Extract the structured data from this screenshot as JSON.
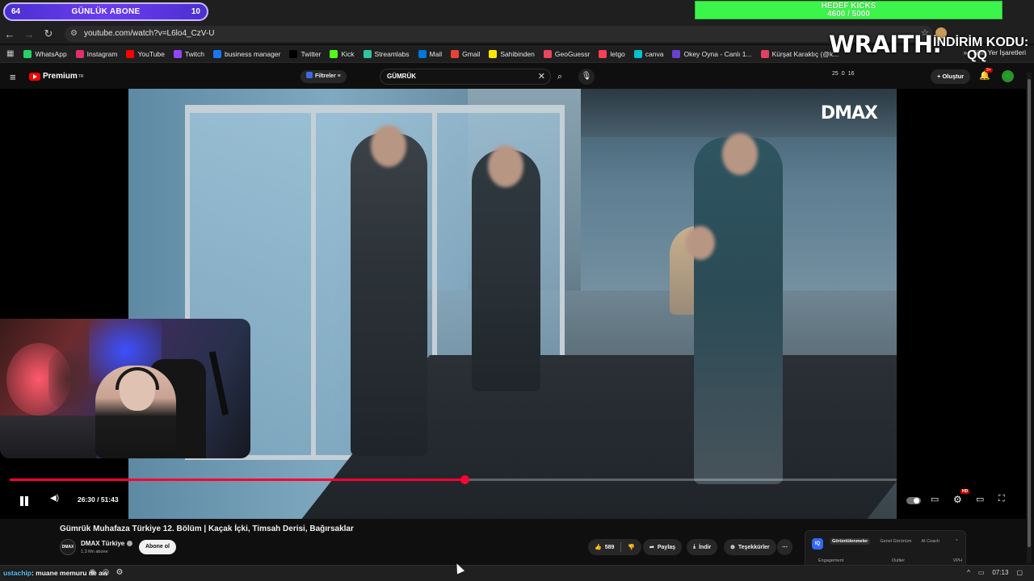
{
  "overlay": {
    "sub_goal": {
      "left": "64",
      "title": "GÜNLÜK ABONE",
      "right": "10"
    },
    "kicks_goal": {
      "title": "HEDEF KICKS",
      "value": "4600 / 5000",
      "progress": 0.92
    },
    "sponsor": {
      "brand": "WRAITH.",
      "promo_label": "İNDİRİM KODU:",
      "promo_code": "QQ"
    }
  },
  "browser": {
    "url": "youtube.com/watch?v=L6lo4_CzV-U",
    "bookmarks": [
      {
        "label": "WhatsApp",
        "color": "#25d366"
      },
      {
        "label": "Instagram",
        "color": "#e1306c"
      },
      {
        "label": "YouTube",
        "color": "#ff0000"
      },
      {
        "label": "Twitch",
        "color": "#9146ff"
      },
      {
        "label": "business manager",
        "color": "#1877f2"
      },
      {
        "label": "Twitter",
        "color": "#000000"
      },
      {
        "label": "Kick",
        "color": "#53fc18"
      },
      {
        "label": "Streamlabs",
        "color": "#31c3a2"
      },
      {
        "label": "Mail",
        "color": "#0078d4"
      },
      {
        "label": "Gmail",
        "color": "#ea4335"
      },
      {
        "label": "Sahibinden",
        "color": "#ffe800"
      },
      {
        "label": "GeoGuessr",
        "color": "#e9475e"
      },
      {
        "label": "letgo",
        "color": "#ff3f55"
      },
      {
        "label": "canva",
        "color": "#00c4cc"
      },
      {
        "label": "Okey Oyna - Canlı 1...",
        "color": "#6c3fd0"
      },
      {
        "label": "Kürşat Karaklıç (@k...",
        "color": "#e4405f"
      }
    ],
    "bookmarks_more": "»",
    "all_bookmarks": "Tüm Yer İşaretleri"
  },
  "youtube": {
    "brand": "Premium",
    "brand_region": "TR",
    "filters_label": "Filtreler",
    "search_value": "GÜMRÜK",
    "stats": [
      "25",
      "0",
      "16"
    ],
    "create_label": "Oluştur",
    "notif_count": "9+",
    "account_initial": "K"
  },
  "player": {
    "watermark": "DMAX",
    "time": "26:30 / 51:43",
    "progress": 0.5124,
    "hd_badge": "HD"
  },
  "video": {
    "title": "Gümrük Muhafaza Türkiye 12. Bölüm | Kaçak İçki, Timsah Derisi, Bağırsaklar",
    "channel": "DMAX Türkiye",
    "channel_avatar_text": "DMAX",
    "subscribers": "1,3 Mn abone",
    "subscribe_label": "Abone ol",
    "likes": "589",
    "share_label": "Paylaş",
    "download_label": "İndir",
    "thanks_label": "Teşekkürler",
    "more_label": "⋯"
  },
  "vidiq": {
    "logo": "IQ",
    "tabs": [
      "Görüntülenmeler",
      "Genel Görünüm",
      "AI Coach"
    ],
    "columns": [
      "Engagement",
      "Outlier",
      "VPH"
    ]
  },
  "taskbar": {
    "chat_user": "ustachip",
    "chat_message": ": muane memuru ne aw",
    "time": "07:13"
  }
}
